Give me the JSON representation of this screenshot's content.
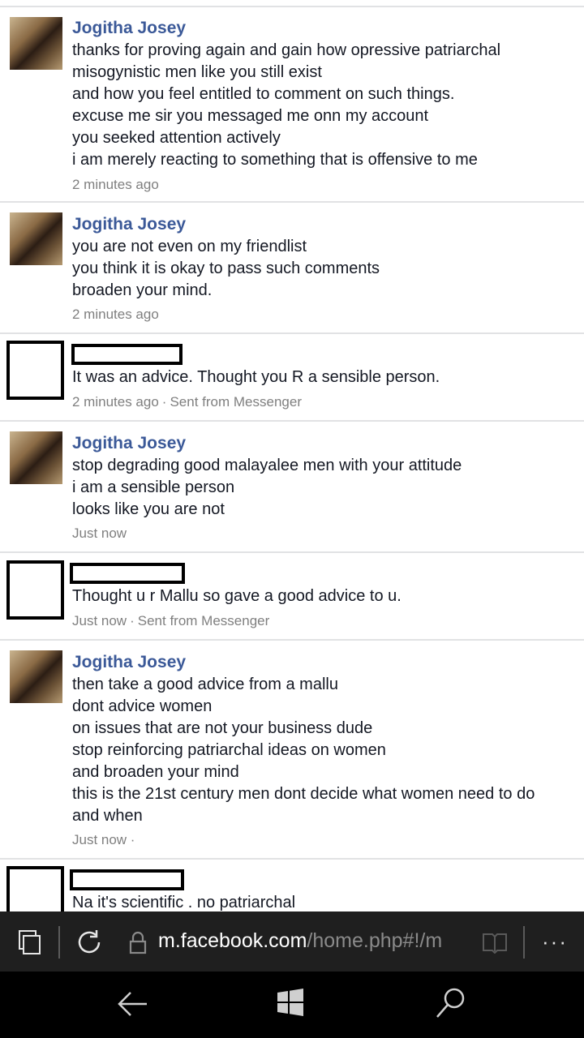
{
  "messages": [
    {
      "name": "Jogitha Josey",
      "lines": [
        "thanks for proving again and gain how opressive patriarchal",
        "misogynistic men like you still exist",
        "and how you feel entitled to comment on such things.",
        "excuse me sir you messaged me onn my account",
        "you seeked attention actively",
        "i am merely reacting to something that is offensive to me"
      ],
      "time": "2 minutes ago"
    },
    {
      "name": "Jogitha Josey",
      "lines": [
        "you are not even on my friendlist",
        "you think it is okay to pass such comments",
        "broaden your mind."
      ],
      "time": "2 minutes ago"
    },
    {
      "lines": [
        "It was an advice. Thought you R a sensible person."
      ],
      "time": "2 minutes ago",
      "source": "Sent from Messenger"
    },
    {
      "name": "Jogitha Josey",
      "lines": [
        "stop degrading good malayalee men with your attitude",
        "i am a sensible person",
        "looks like you are not"
      ],
      "time": "Just now"
    },
    {
      "lines": [
        "Thought u r Mallu so gave a good advice to u."
      ],
      "time": "Just now",
      "source": "Sent from Messenger"
    },
    {
      "name": "Jogitha Josey",
      "lines": [
        "then take a good advice from a mallu",
        "dont advice women",
        "on issues that are not your business dude",
        "stop reinforcing patriarchal ideas on women",
        "and broaden your mind",
        "this is the 21st century men dont decide what women need to do",
        "and when"
      ],
      "time": "Just now ·"
    },
    {
      "lines": [
        "Na it's scientific . no patriarchal"
      ]
    }
  ],
  "browser": {
    "url_host": "m.facebook.com",
    "url_rest": "/home.php#!/m",
    "tabs_icon": "tabs-icon",
    "refresh_icon": "refresh-icon",
    "lock_icon": "lock-icon",
    "reading_icon": "reading-view-icon",
    "more_label": "···"
  },
  "taskbar": {
    "back_icon": "back-arrow-icon",
    "windows_icon": "windows-logo-icon",
    "search_icon": "search-icon"
  }
}
